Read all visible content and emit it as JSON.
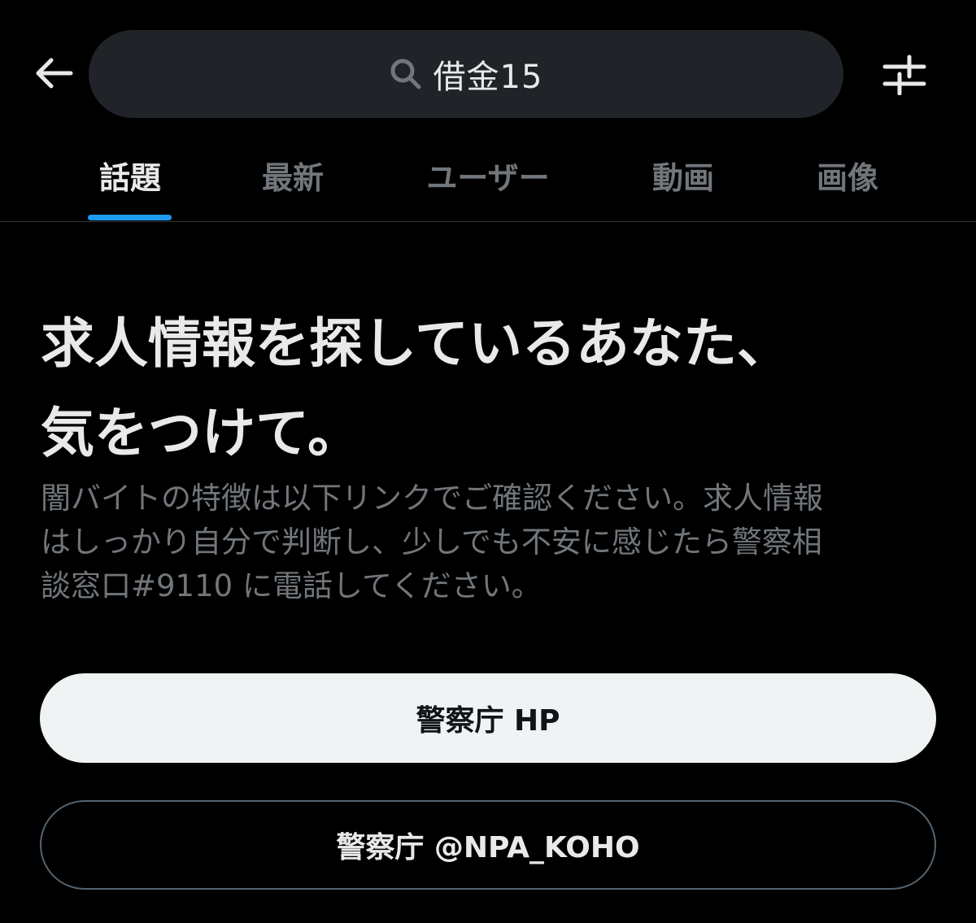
{
  "header": {
    "back_icon": "arrow-left-icon",
    "search": {
      "icon": "search-icon",
      "query": "借金15"
    },
    "filter_icon": "sliders-icon"
  },
  "tabs": [
    {
      "label": "話題",
      "active": true
    },
    {
      "label": "最新",
      "active": false
    },
    {
      "label": "ユーザー",
      "active": false
    },
    {
      "label": "動画",
      "active": false
    },
    {
      "label": "画像",
      "active": false
    }
  ],
  "notice": {
    "headline_line1": "求人情報を探しているあなた、",
    "headline_line2": "気をつけて。",
    "body_line1": "闇バイトの特徴は以下リンクでご確認ください。求人情報",
    "body_line2": "はしっかり自分で判断し、少しでも不安に感じたら警察相",
    "body_line3": "談窓口#9110 に電話してください。"
  },
  "buttons": {
    "primary_label": "警察庁 HP",
    "secondary_label": "警察庁 @NPA_KOHO"
  },
  "colors": {
    "background": "#000000",
    "accent": "#1d9bf0",
    "text_primary": "#e7e9ea",
    "text_secondary": "#71767b",
    "search_bg": "#202327",
    "primary_button_bg": "#eff3f4"
  }
}
